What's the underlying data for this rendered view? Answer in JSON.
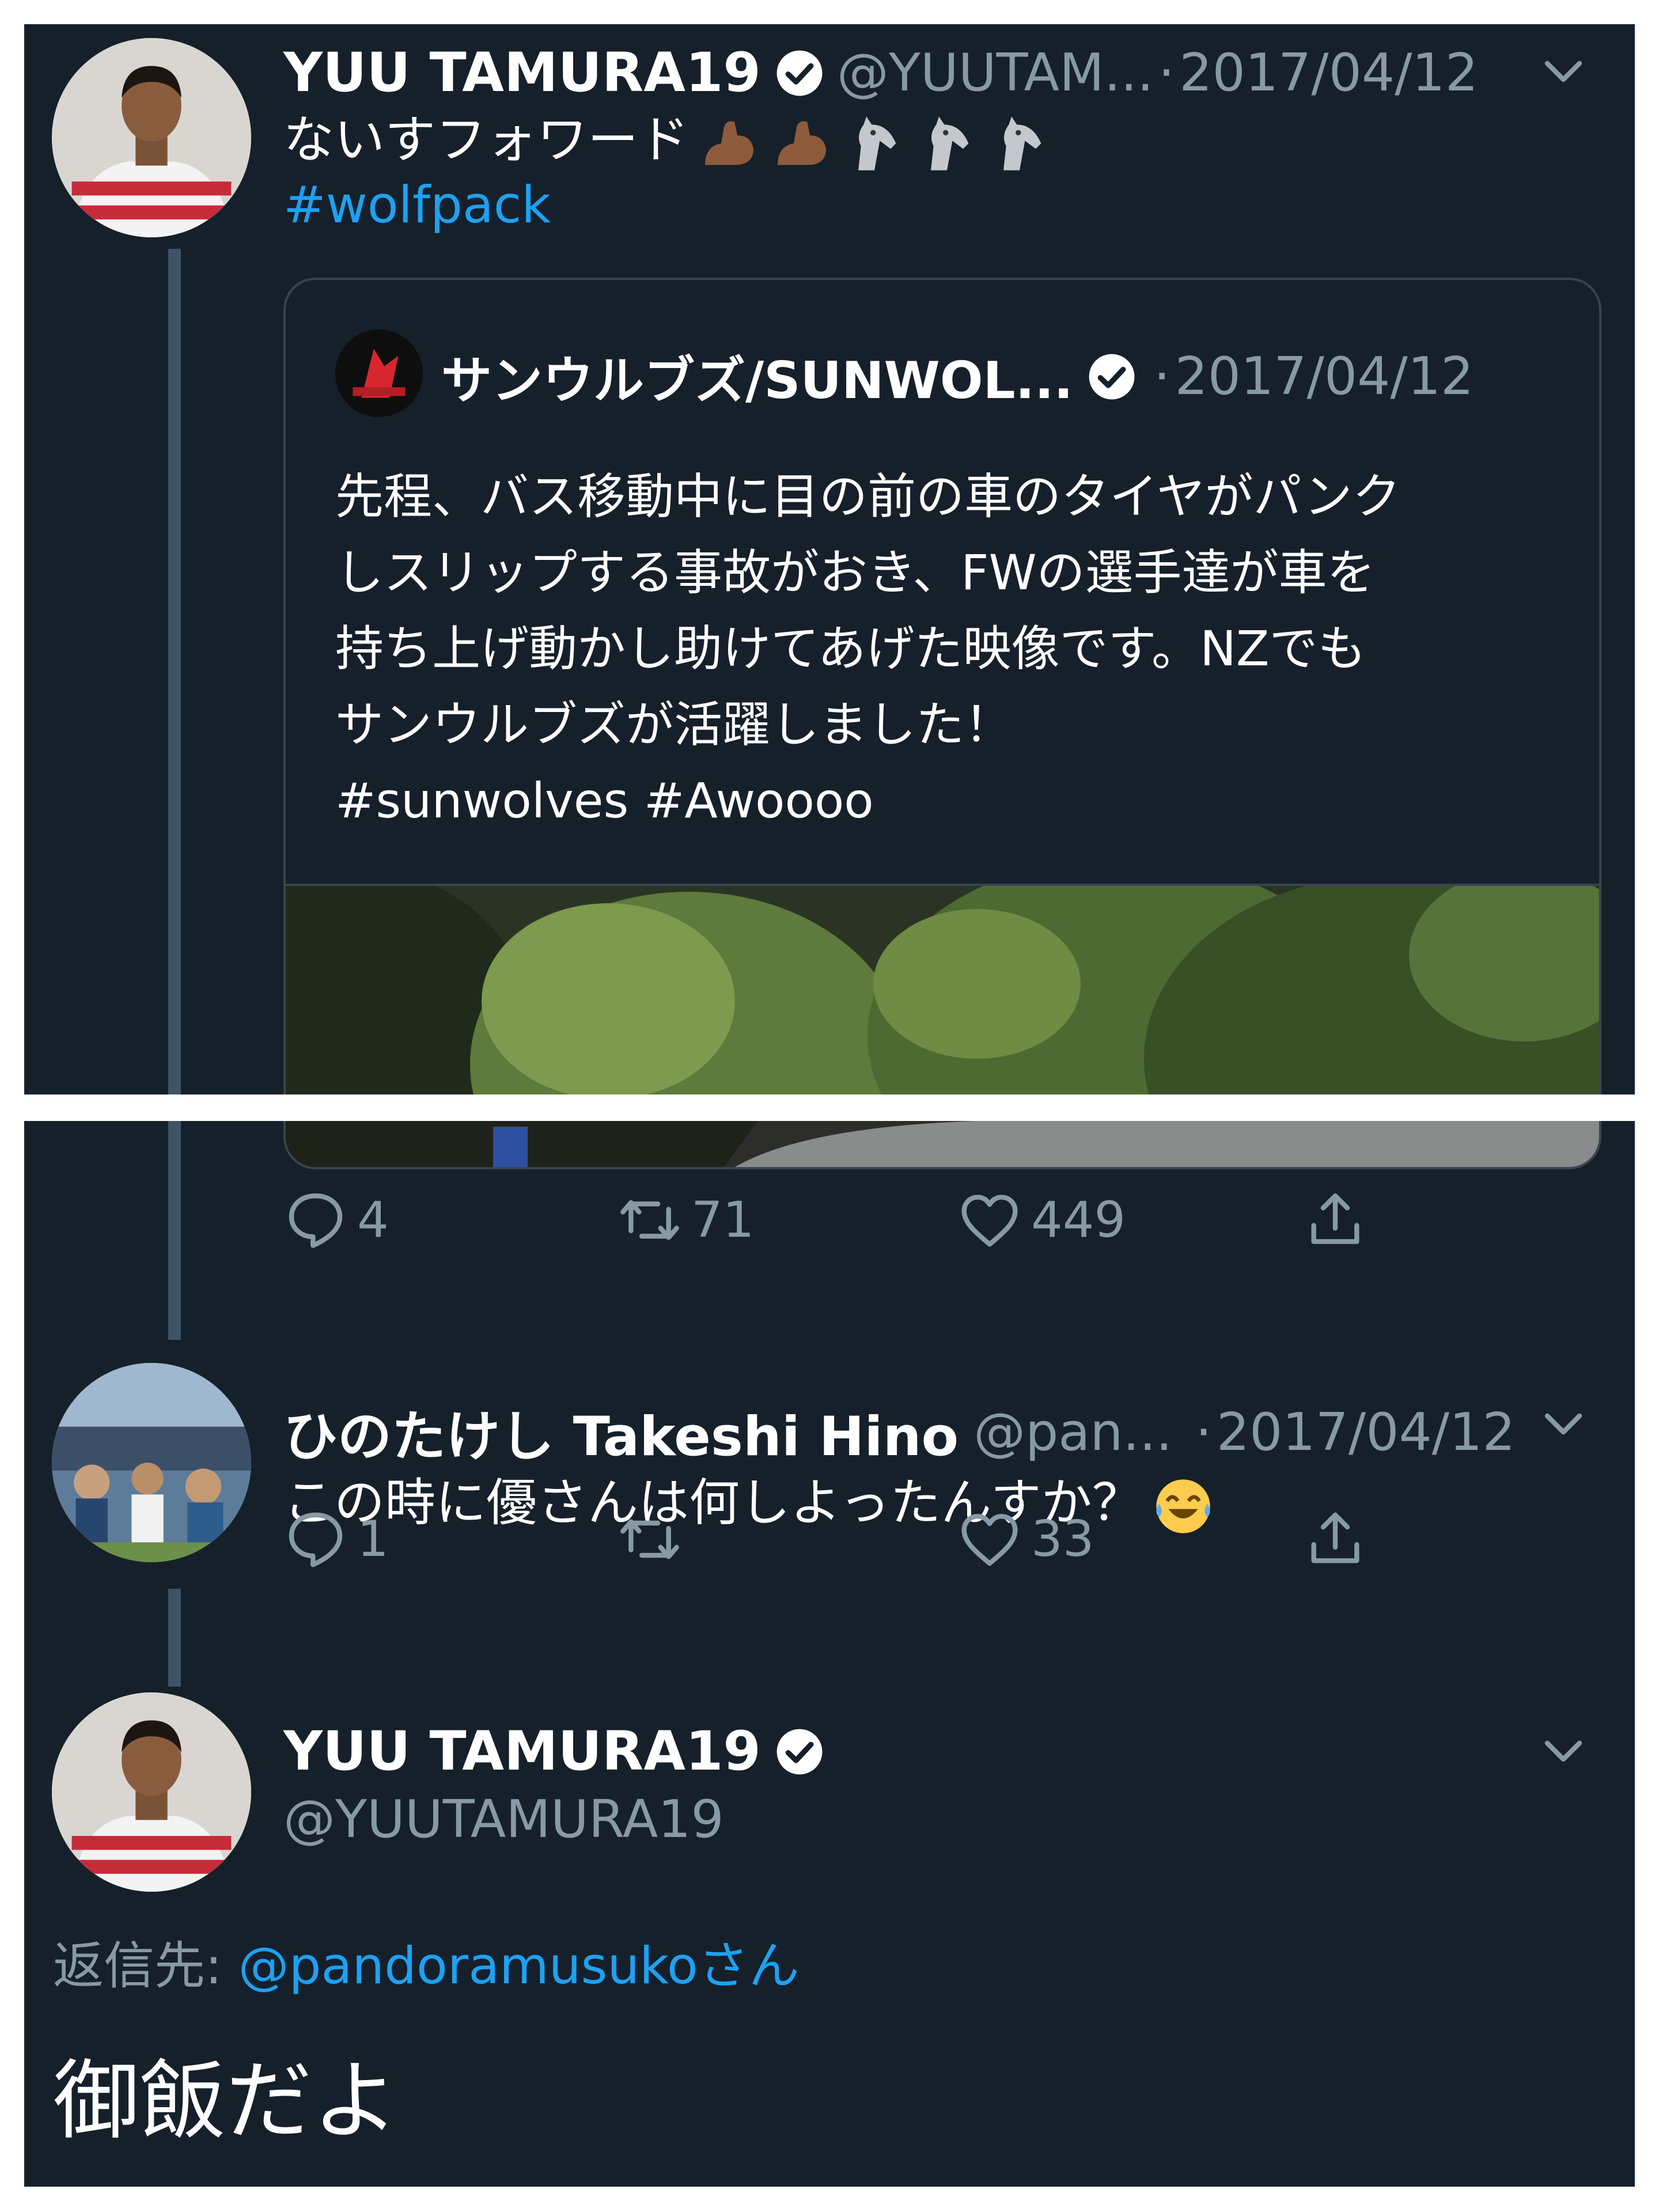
{
  "tweet1": {
    "name": "YUU TAMURA19",
    "handle": "@YUUTAM...",
    "separator": "·",
    "date": "2017/04/12",
    "text": "ないすフォワード",
    "hashtag": "#wolfpack",
    "emojis": [
      "flexed-biceps-emoji",
      "flexed-biceps-emoji",
      "horse-emoji",
      "horse-emoji",
      "horse-emoji"
    ]
  },
  "quote": {
    "name": "サンウルブズ/SUNWOL...",
    "separator": "·",
    "date": "2017/04/12",
    "lines": [
      "先程、バス移動中に目の前の車のタイヤがパンク",
      "しスリップする事故がおき、FWの選手達が車を",
      "持ち上げ動かし助けてあげた映像です。NZでも",
      "サンウルブズが活躍しました！",
      "#sunwolves #Awoooo"
    ]
  },
  "tweet1_actions": {
    "replies": "4",
    "retweets": "71",
    "likes": "449"
  },
  "tweet2": {
    "name": "ひのたけし Takeshi Hino",
    "handle": "@pan...",
    "separator": "·",
    "date": "2017/04/12",
    "text": "この時に優さんは何しよったんすか？",
    "emoji": "face-with-tears-of-joy-emoji"
  },
  "tweet2_actions": {
    "replies": "1",
    "retweets": "",
    "likes": "33"
  },
  "tweet3": {
    "name": "YUU TAMURA19",
    "handle": "@YUUTAMURA19",
    "reply_label": "返信先: ",
    "reply_mention": "@pandoramusuko",
    "reply_suffix": "さん",
    "text": "御飯だよ"
  },
  "colors": {
    "background": "#15202b",
    "link": "#1da1f2",
    "secondary_text": "#8899a6",
    "thread_line": "#3d5466"
  }
}
